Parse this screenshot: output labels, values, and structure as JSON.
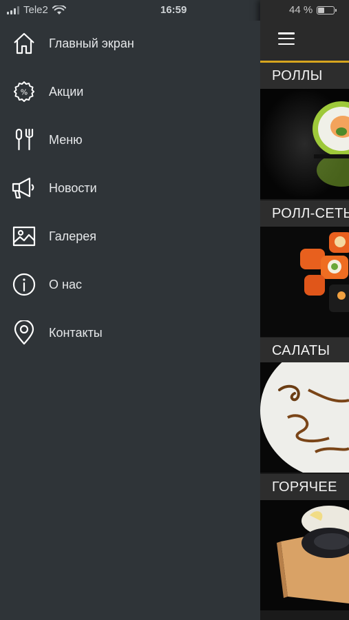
{
  "status_bar": {
    "carrier": "Tele2",
    "time": "16:59",
    "battery": "44 %",
    "battery_level": 0.44
  },
  "drawer": {
    "items": [
      {
        "label": "Главный экран",
        "icon": "home-icon"
      },
      {
        "label": "Акции",
        "icon": "percent-badge-icon"
      },
      {
        "label": "Меню",
        "icon": "fork-spoon-icon"
      },
      {
        "label": "Новости",
        "icon": "megaphone-icon"
      },
      {
        "label": "Галерея",
        "icon": "image-icon"
      },
      {
        "label": "О нас",
        "icon": "info-icon"
      },
      {
        "label": "Контакты",
        "icon": "location-pin-icon"
      }
    ]
  },
  "main": {
    "menu_icon": "hamburger-icon",
    "categories": [
      {
        "label": "РОЛЛЫ"
      },
      {
        "label": "РОЛЛ-СЕТЫ"
      },
      {
        "label": "САЛАТЫ"
      },
      {
        "label": "ГОРЯЧЕЕ"
      }
    ]
  },
  "colors": {
    "drawer_bg": "#2f3438",
    "accent": "#d7a51e",
    "text": "#e6e8ea"
  }
}
